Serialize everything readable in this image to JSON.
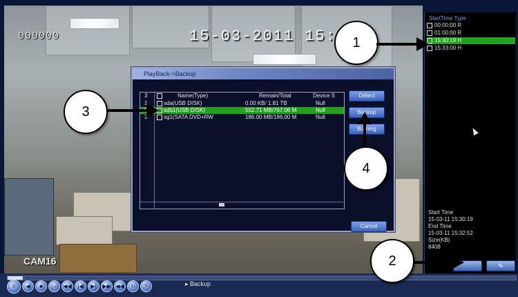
{
  "osd": {
    "counter": "000000",
    "datetime": "15-03-2011 15:3",
    "camera": "CAM16"
  },
  "file_list": {
    "header": "StartTime Type",
    "items": [
      {
        "time": "00:00:00",
        "type": "R",
        "selected": false
      },
      {
        "time": "01:00:00",
        "type": "R",
        "selected": false
      },
      {
        "time": "15:30:19",
        "type": "H",
        "selected": true
      },
      {
        "time": "15:33:00",
        "type": "H",
        "selected": false
      }
    ]
  },
  "info": {
    "start_time_label": "Start Time",
    "start_time": "15-03-11 15:30:19",
    "end_time_label": "End Time",
    "end_time": "15-03-11 15:32:52",
    "size_label": "Size(KB)",
    "size": "8408"
  },
  "dialog": {
    "title": "PlayBack->Backup",
    "columns": {
      "index": "3",
      "name": "Name(Type)",
      "remain": "Remain/Total",
      "status": "Device S"
    },
    "rows": [
      {
        "index": "1",
        "name": "sda(USB DISK)",
        "remain": "0.00 KB/ 1.81 TB",
        "status": "Null",
        "selected": false
      },
      {
        "index": "2",
        "name": "sdb1(USB DISK)",
        "remain": "552.71 MB/767.06 M",
        "status": "Null",
        "selected": true
      },
      {
        "index": "3",
        "name": "sg1(SATA DVD+RW",
        "remain": "186.00 MB/186.00 M",
        "status": "Null",
        "selected": false
      }
    ],
    "buttons": {
      "detect": "Detect",
      "backup": "Backup",
      "burning": "Burning",
      "cancel": "Cancel"
    }
  },
  "playback": {
    "status": "Backup",
    "progress_fraction": 0.03,
    "controls": [
      {
        "name": "pause",
        "glyph": "II"
      },
      {
        "name": "slow-backward",
        "glyph": "◀"
      },
      {
        "name": "stop",
        "glyph": "■"
      },
      {
        "name": "slow-forward",
        "glyph": "▷"
      },
      {
        "name": "fast-backward",
        "glyph": "◀◀"
      },
      {
        "name": "prev-file",
        "glyph": "|◀"
      },
      {
        "name": "next-file",
        "glyph": "▶|"
      },
      {
        "name": "fast-forward",
        "glyph": "▶▶"
      },
      {
        "name": "step-back",
        "glyph": "◀◀"
      },
      {
        "name": "repeat",
        "glyph": "↻"
      },
      {
        "name": "backup",
        "glyph": "⎘"
      }
    ]
  },
  "annotations": [
    "1",
    "2",
    "3",
    "4"
  ],
  "colors": {
    "selection": "#22a31d",
    "dialog_bg": "#0a0f2a",
    "button": "#3c62c0"
  }
}
